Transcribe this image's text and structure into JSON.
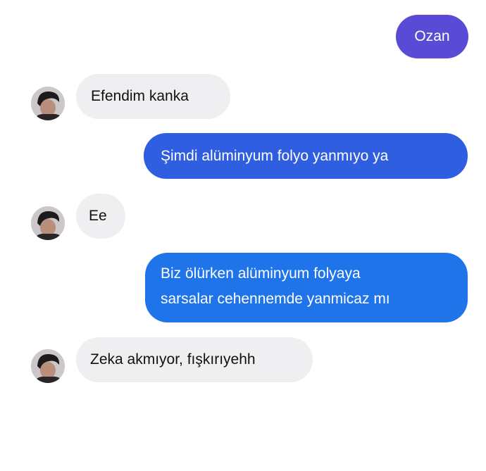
{
  "colors": {
    "outgoing_purple": "#5a4bd6",
    "outgoing_blue": "#2f5fe0",
    "outgoing_light_blue": "#1f74ea",
    "incoming_bg": "#efeff1"
  },
  "messages": [
    {
      "side": "outgoing",
      "text": "Ozan"
    },
    {
      "side": "incoming",
      "text": "Efendim kanka",
      "avatar": "contact-avatar"
    },
    {
      "side": "outgoing",
      "text": "Şimdi alüminyum folyo yanmıyo ya"
    },
    {
      "side": "incoming",
      "text": "Ee",
      "avatar": "contact-avatar"
    },
    {
      "side": "outgoing",
      "lines": [
        "Biz ölürken alüminyum folyaya",
        "sarsalar cehennemde yanmicaz mı"
      ]
    },
    {
      "side": "incoming",
      "text": "Zeka akmıyor, fışkırıyehh",
      "avatar": "contact-avatar"
    }
  ]
}
